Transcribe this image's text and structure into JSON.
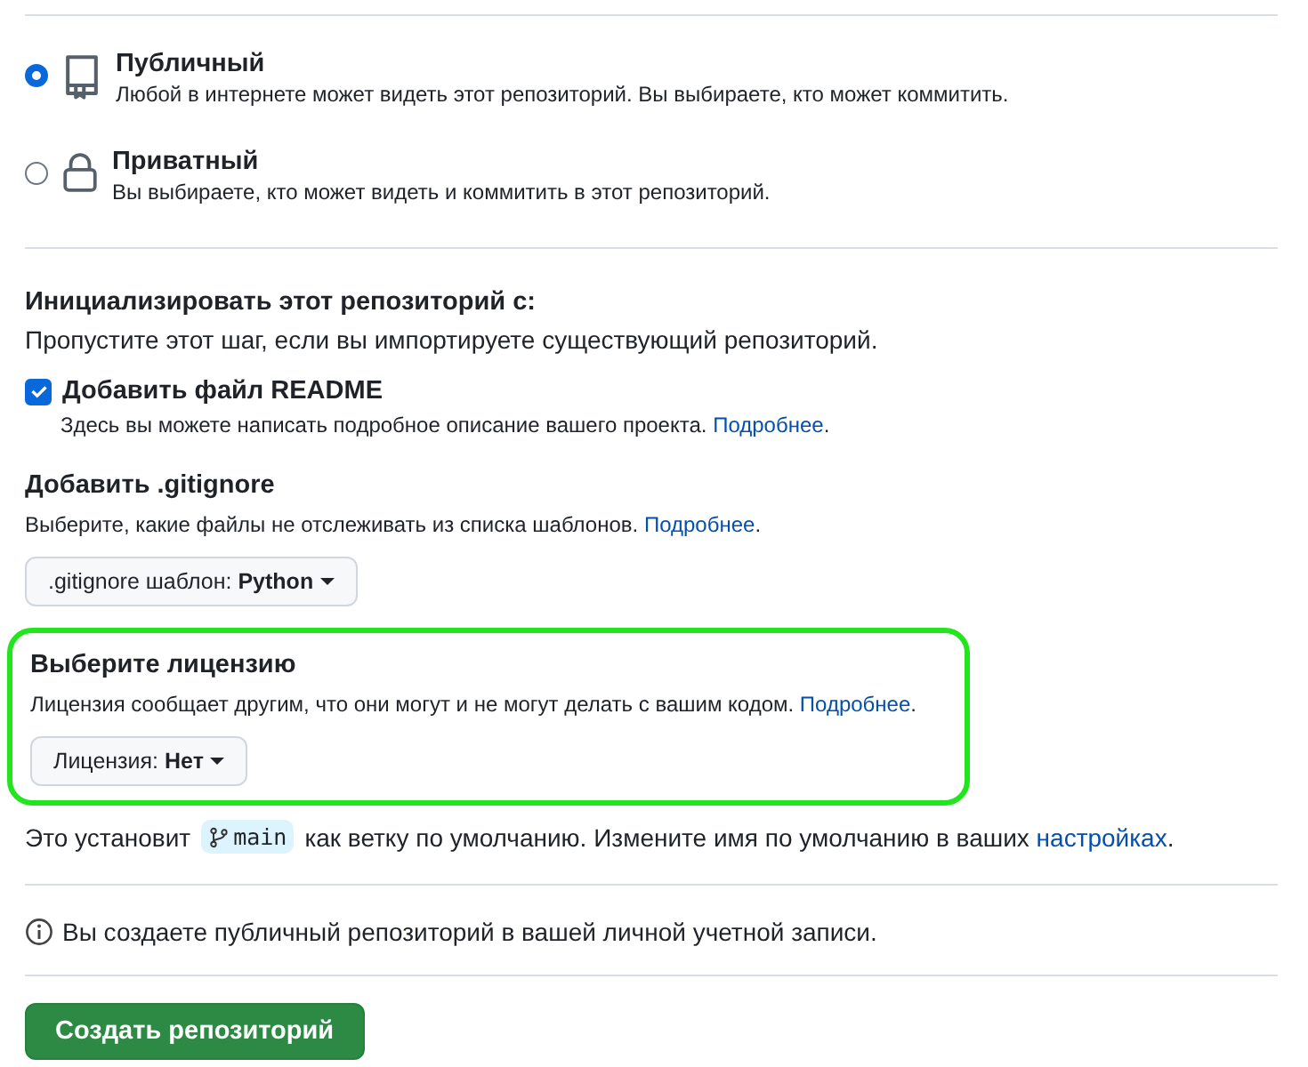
{
  "visibility": [
    {
      "kind": "public",
      "label": "Публичный",
      "description": "Любой в интернете может видеть этот репозиторий. Вы выбираете, кто может коммитить.",
      "selected": true
    },
    {
      "kind": "private",
      "label": "Приватный",
      "description": "Вы выбираете, кто может видеть и коммитить в этот репозиторий.",
      "selected": false
    }
  ],
  "initialize": {
    "title": "Инициализировать этот репозиторий с:",
    "description": "Пропустите этот шаг, если вы импортируете существующий репозиторий."
  },
  "readme": {
    "label": "Добавить файл README",
    "checked": true,
    "description": "Здесь вы можете написать подробное описание вашего проекта. ",
    "link": "Подробнее",
    "after": "."
  },
  "gitignore": {
    "title": "Добавить .gitignore",
    "description": "Выберите, какие файлы не отслеживать из списка шаблонов. ",
    "link": "Подробнее",
    "after": ".",
    "dropdown": ".gitignore шаблон: **Python**"
  },
  "license": {
    "highlighted": true,
    "title": "Выберите лицензию",
    "description": "Лицензия сообщает другим, что они могут и не могут делать с вашим кодом. ",
    "link": "Подробнее",
    "after": ".",
    "dropdown": "Лицензия: **Нет**"
  },
  "branch_note": {
    "before": "Это установит",
    "branch": "main",
    "middle": "как ветку по умолчанию. Измените имя по умолчанию в ваших",
    "link": "настройках",
    "after": "."
  },
  "info": "Вы создаете публичный репозиторий в вашей личной учетной записи.",
  "submit": "Создать репозиторий"
}
